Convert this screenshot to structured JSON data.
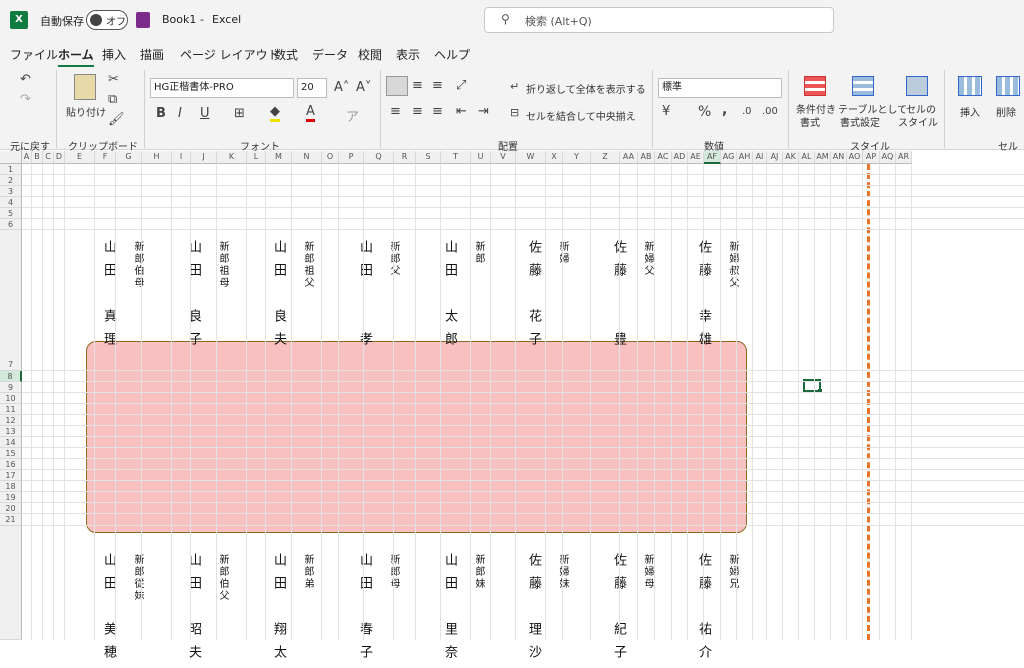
{
  "titlebar": {
    "app_icon": "excel-icon",
    "autosave_label": "自動保存",
    "autosave_state": "オフ",
    "filename": "Book1",
    "separator": "-",
    "app_name": "Excel",
    "search_placeholder": "検索 (Alt+Q)"
  },
  "menu": [
    "ファイル",
    "ホーム",
    "挿入",
    "描画",
    "ページ レイアウト",
    "数式",
    "データ",
    "校閲",
    "表示",
    "ヘルプ"
  ],
  "ribbon": {
    "undo_group": "元に戻す",
    "clipboard": {
      "paste": "貼り付け",
      "group": "クリップボード"
    },
    "font": {
      "name": "HG正楷書体-PRO",
      "size": "20",
      "group": "フォント",
      "bold": "B",
      "italic": "I",
      "underline": "U"
    },
    "alignment": {
      "wrap": "折り返して全体を表示する",
      "merge": "セルを結合して中央揃え",
      "group": "配置"
    },
    "number": {
      "format": "標準",
      "group": "数値",
      "percent": "%",
      "comma": ","
    },
    "styles": {
      "conditional": "条件付き",
      "conditional2": "書式",
      "table": "テーブルとして",
      "table2": "書式設定",
      "cell": "セルの",
      "cell2": "スタイル",
      "group": "スタイル"
    },
    "cells": {
      "insert": "挿入",
      "delete": "削除",
      "group": "セル"
    }
  },
  "columns": [
    "A",
    "B",
    "C",
    "D",
    "E",
    "F",
    "G",
    "H",
    "I",
    "J",
    "K",
    "L",
    "M",
    "N",
    "O",
    "P",
    "Q",
    "R",
    "S",
    "T",
    "U",
    "V",
    "W",
    "X",
    "Y",
    "Z",
    "AA",
    "AB",
    "AC",
    "AD",
    "AE",
    "AF",
    "AG",
    "AH",
    "AI",
    "AJ",
    "AK",
    "AL",
    "AM",
    "AN",
    "AO",
    "AP",
    "AQ",
    "AR"
  ],
  "rows": [
    "1",
    "2",
    "3",
    "4",
    "5",
    "6",
    "7",
    "8",
    "9",
    "10",
    "11",
    "12",
    "13",
    "14",
    "15",
    "16",
    "17",
    "18",
    "19",
    "20",
    "21"
  ],
  "top_guests": [
    {
      "name": "山田　真理",
      "role": "新郎伯母"
    },
    {
      "name": "山田　良子",
      "role": "新郎祖母"
    },
    {
      "name": "山田　良夫",
      "role": "新郎祖父"
    },
    {
      "name": "山田　　孝",
      "role": "新郎父"
    },
    {
      "name": "山田　太郎",
      "role": "新郎"
    },
    {
      "name": "佐藤　花子",
      "role": "新婦"
    },
    {
      "name": "佐藤　　豊",
      "role": "新婦父"
    },
    {
      "name": "佐藤　幸雄",
      "role": "新婦叔父"
    }
  ],
  "bottom_guests": [
    {
      "name": "山田　美穂",
      "role": "新郎従妹"
    },
    {
      "name": "山田　昭夫",
      "role": "新郎伯父"
    },
    {
      "name": "山田　翔太",
      "role": "新郎弟"
    },
    {
      "name": "山田　春子",
      "role": "新郎母"
    },
    {
      "name": "山田　里奈",
      "role": "新郎妹"
    },
    {
      "name": "佐藤　理沙",
      "role": "新婦妹"
    },
    {
      "name": "佐藤　紀子",
      "role": "新婦母"
    },
    {
      "name": "佐藤　祐介",
      "role": "新婦兄"
    }
  ],
  "colors": {
    "table_fill": "#f8c0c0",
    "table_border": "#8a6a20",
    "page_break": "#e8742a",
    "accent": "#107c41"
  }
}
